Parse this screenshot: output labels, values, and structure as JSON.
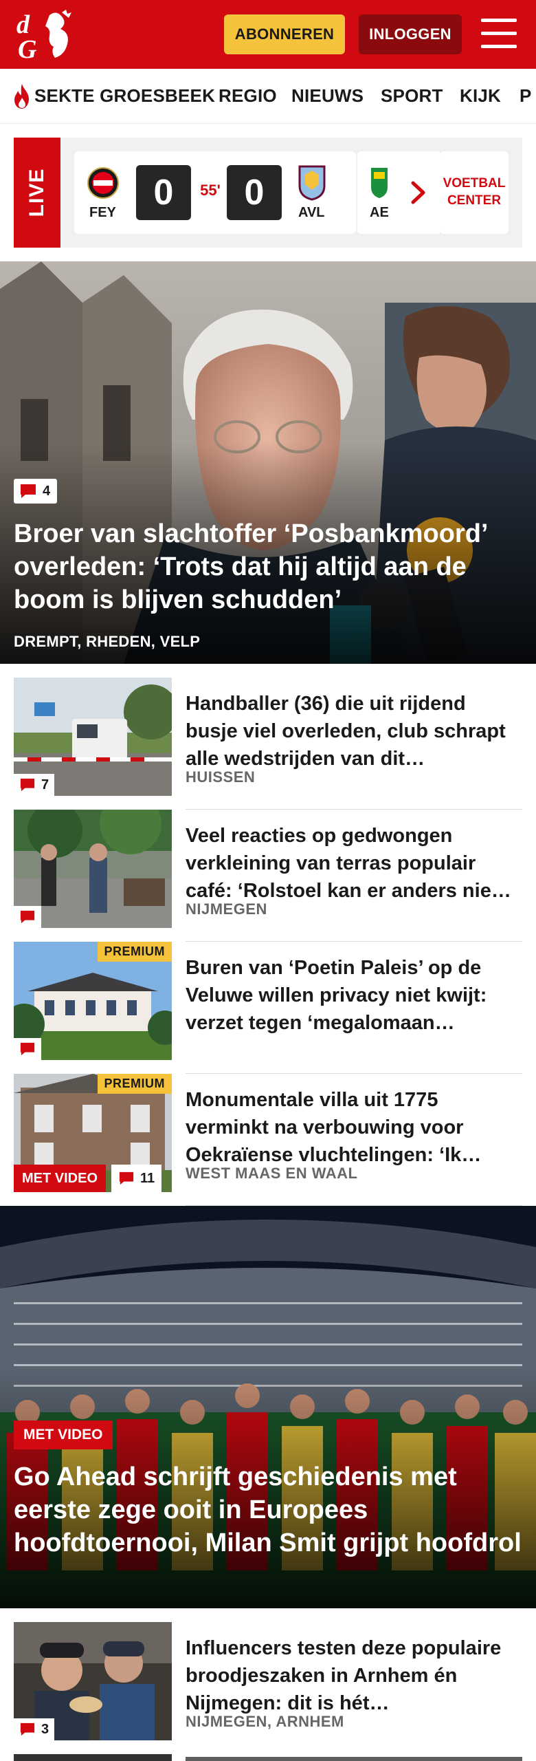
{
  "header": {
    "logo_text": "dG",
    "subscribe_label": "ABONNEREN",
    "login_label": "INLOGGEN",
    "brand_color": "#d10a11"
  },
  "nav": {
    "items": [
      {
        "label": "SEKTE GROESBEEK",
        "icon": "flame-icon"
      },
      {
        "label": "REGIO"
      },
      {
        "label": "NIEUWS"
      },
      {
        "label": "SPORT"
      },
      {
        "label": "KIJK"
      },
      {
        "label": "P"
      }
    ]
  },
  "live": {
    "label": "LIVE",
    "match": {
      "home_code": "FEY",
      "home_score": "0",
      "minute": "55'",
      "away_score": "0",
      "away_code": "AVL"
    },
    "next_match_code": "AE",
    "center_label_1": "VOETBAL",
    "center_label_2": "CENTER"
  },
  "hero": {
    "comments": "4",
    "title": "Broer van slachtoffer ‘Posbankmoord’ overleden: ‘Trots dat hij altijd aan de boom is blijven schudden’",
    "location": "DREMPT, RHEDEN, VELP"
  },
  "articles": [
    {
      "title": "Handballer (36) die uit rijdend busje viel overleden, club schrapt alle wedstrijden van dit…",
      "location": "HUISSEN",
      "comments": "7"
    },
    {
      "title": "Veel reacties op gedwongen verkleining van terras populair café: ‘Rolstoel kan er anders nie…",
      "location": "NIJMEGEN",
      "comments": ""
    },
    {
      "title": "Buren van ‘Poetin Paleis’ op de Veluwe willen privacy niet kwijt: verzet tegen ‘megalomaan…",
      "location": "",
      "comments": "",
      "premium": "PREMIUM"
    },
    {
      "title": "Monumentale villa uit 1775 verminkt na verbouwing voor Oekraïense vluchtelingen: ‘Ik…",
      "location": "WEST MAAS EN WAAL",
      "comments": "11",
      "premium": "PREMIUM",
      "video": "MET VIDEO"
    }
  ],
  "hero2": {
    "video": "MET VIDEO",
    "title": "Go Ahead schrijft geschiedenis met eerste zege ooit in Europees hoofdtoernooi, Milan Smit grijpt hoofdrol"
  },
  "articles2": [
    {
      "title": "Influencers testen deze populaire broodjeszaken in Arnhem én Nijmegen: dit is hét…",
      "location": "NIJMEGEN, ARNHEM",
      "comments": "3"
    }
  ]
}
